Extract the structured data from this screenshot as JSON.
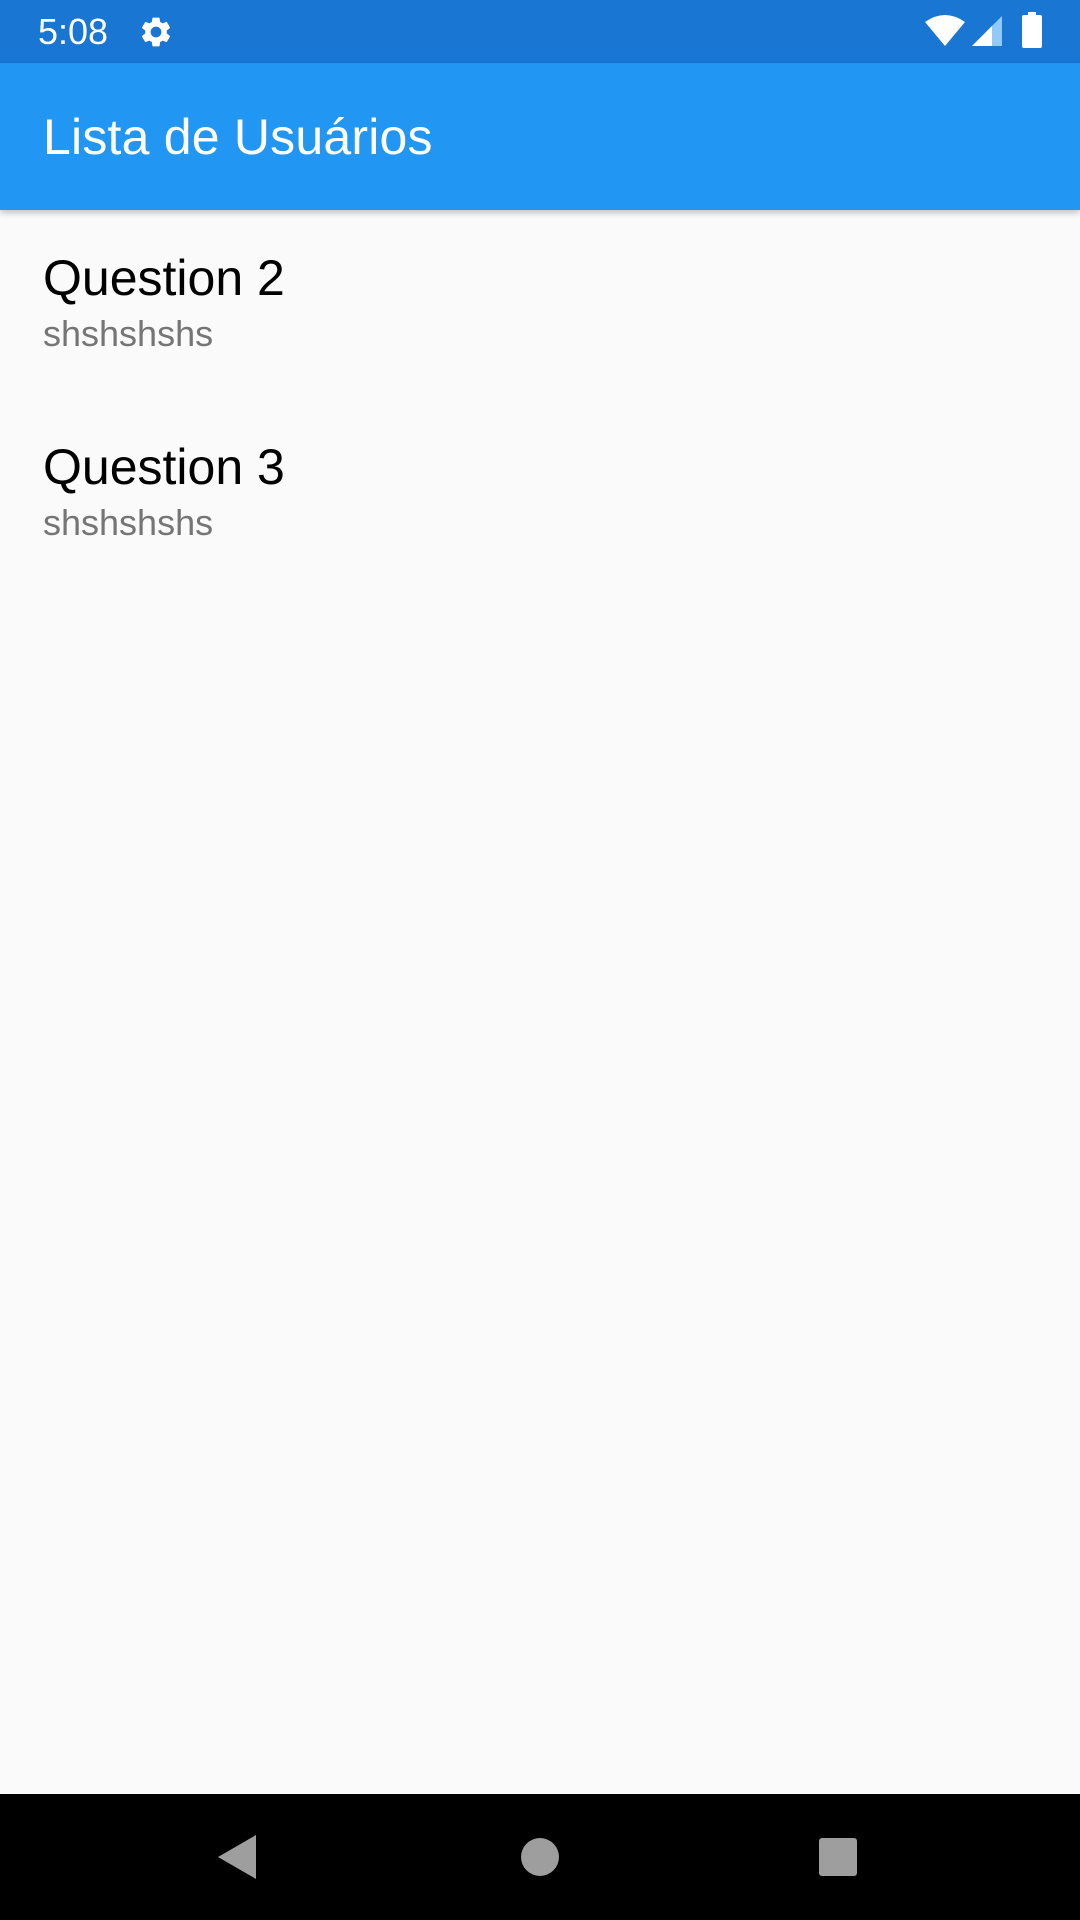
{
  "status_bar": {
    "time": "5:08",
    "icons": [
      "settings-icon",
      "wifi-icon",
      "cell-signal-icon",
      "battery-icon"
    ],
    "background": "#1976d2"
  },
  "app_bar": {
    "title": "Lista de Usuários",
    "background": "#2196f3"
  },
  "list": {
    "items": [
      {
        "title": "Question 2",
        "subtitle": "shshshshs"
      },
      {
        "title": "Question 3",
        "subtitle": "shshshshs"
      }
    ]
  },
  "nav_bar": {
    "buttons": [
      "back-icon",
      "home-icon",
      "recents-icon"
    ]
  }
}
